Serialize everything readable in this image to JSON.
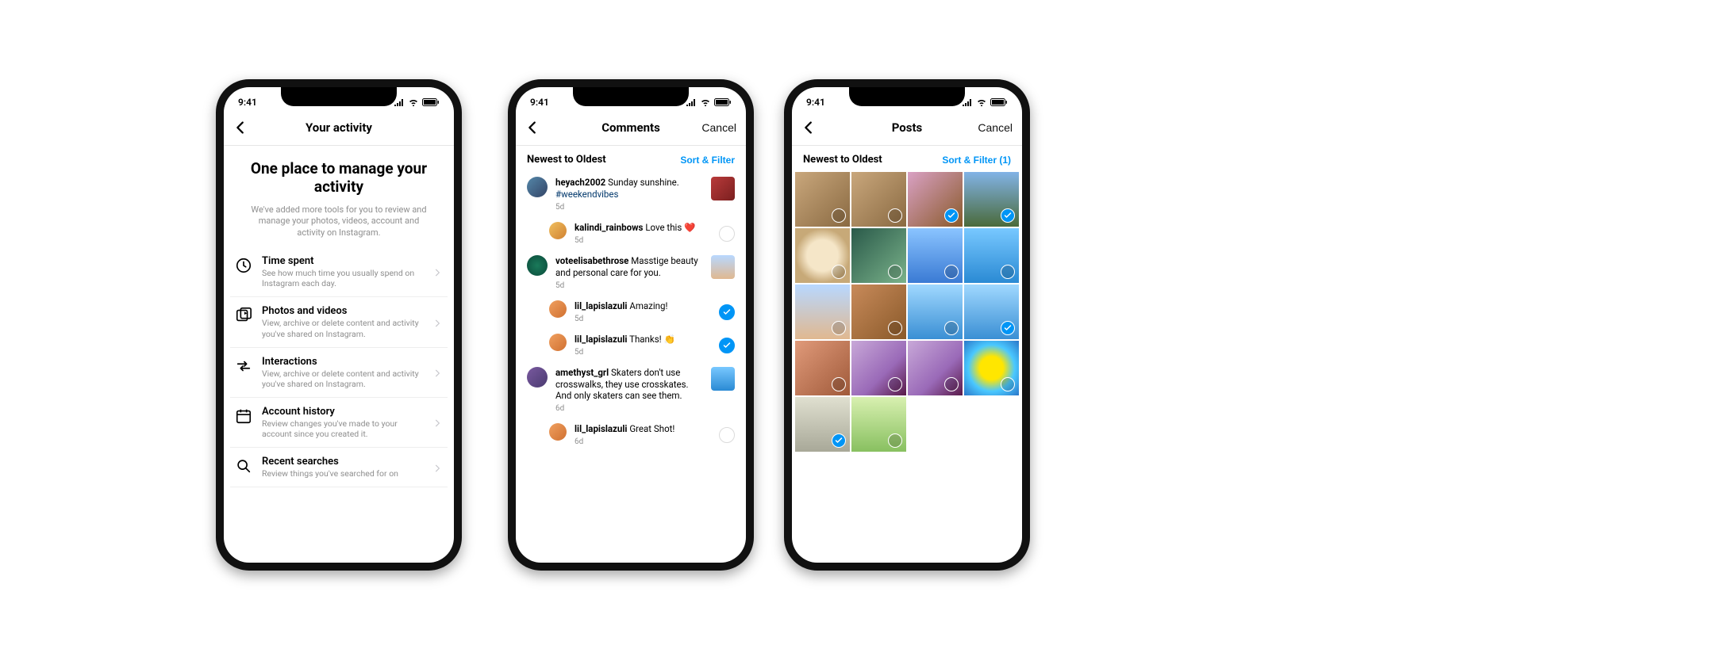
{
  "statusbar": {
    "time": "9:41"
  },
  "colors": {
    "link": "#0095f6"
  },
  "phone1": {
    "title": "Your activity",
    "hero_title": "One place to manage your activity",
    "hero_subtitle": "We've added more tools for you to review and manage your photos, videos, account and activity on Instagram.",
    "items": [
      {
        "icon": "clock",
        "title": "Time spent",
        "subtitle": "See how much time you usually spend on Instagram each day."
      },
      {
        "icon": "media",
        "title": "Photos and videos",
        "subtitle": "View, archive or delete content and activity you've shared on Instagram."
      },
      {
        "icon": "arrows",
        "title": "Interactions",
        "subtitle": "View, archive or delete content and activity you've shared on Instagram."
      },
      {
        "icon": "calendar",
        "title": "Account history",
        "subtitle": "Review changes you've made to your account since you created it."
      },
      {
        "icon": "search",
        "title": "Recent searches",
        "subtitle": "Review things you've searched for on"
      }
    ]
  },
  "phone2": {
    "title": "Comments",
    "cancel": "Cancel",
    "sort_label": "Newest to Oldest",
    "sort_button": "Sort & Filter",
    "comments": [
      {
        "id": 0,
        "reply": false,
        "user": "heyach2002",
        "text": "Sunday sunshine.",
        "extra": "#weekendvibes",
        "meta": "5d",
        "thumb": true,
        "thumb_class": "g-red",
        "check": false,
        "checked": false,
        "avatar_bg": "linear-gradient(135deg,#58a,#346)"
      },
      {
        "id": 1,
        "reply": true,
        "user": "kalindi_rainbows",
        "text": "Love this ❤️",
        "meta": "5d",
        "thumb": false,
        "check": true,
        "checked": false,
        "avatar_bg": "linear-gradient(135deg,#f0c060,#d08030)"
      },
      {
        "id": 2,
        "reply": false,
        "user": "voteelisabethrose",
        "text": "Masstige beauty and personal care for you.",
        "meta": "5d",
        "thumb": true,
        "thumb_class": "g-model",
        "check": false,
        "checked": false,
        "avatar_bg": "radial-gradient(#1a7a5a,#0a4a3a)"
      },
      {
        "id": 3,
        "reply": true,
        "user": "lil_lapislazuli",
        "text": "Amazing!",
        "meta": "5d",
        "thumb": false,
        "check": true,
        "checked": true,
        "avatar_bg": "linear-gradient(135deg,#f0a060,#d07030)"
      },
      {
        "id": 4,
        "reply": true,
        "user": "lil_lapislazuli",
        "text": "Thanks! 👏",
        "meta": "5d",
        "thumb": false,
        "check": true,
        "checked": true,
        "avatar_bg": "linear-gradient(135deg,#f0a060,#d07030)"
      },
      {
        "id": 5,
        "reply": false,
        "user": "amethyst_grl",
        "text": "Skaters don't use crosswalks, they use crosskates. And only skaters can see them.",
        "meta": "6d",
        "thumb": true,
        "thumb_class": "g-skate",
        "check": false,
        "checked": false,
        "avatar_bg": "linear-gradient(135deg,#7a5aa0,#4a3a70)"
      },
      {
        "id": 6,
        "reply": true,
        "user": "lil_lapislazuli",
        "text": "Great Shot!",
        "meta": "6d",
        "thumb": false,
        "check": true,
        "checked": false,
        "avatar_bg": "linear-gradient(135deg,#f0a060,#d07030)"
      }
    ]
  },
  "phone3": {
    "title": "Posts",
    "cancel": "Cancel",
    "sort_label": "Newest to Oldest",
    "sort_button": "Sort & Filter (1)",
    "tiles": [
      {
        "id": 0,
        "bg": "g-group",
        "checked": false
      },
      {
        "id": 1,
        "bg": "g-group",
        "checked": false
      },
      {
        "id": 2,
        "bg": "g-flowers",
        "checked": true
      },
      {
        "id": 3,
        "bg": "g-hill",
        "checked": true
      },
      {
        "id": 4,
        "bg": "g-umbrella",
        "checked": false
      },
      {
        "id": 5,
        "bg": "g-camera",
        "checked": false
      },
      {
        "id": 6,
        "bg": "g-yoga",
        "checked": false
      },
      {
        "id": 7,
        "bg": "g-skate",
        "checked": false
      },
      {
        "id": 8,
        "bg": "g-model",
        "checked": false
      },
      {
        "id": 9,
        "bg": "g-barcelona",
        "checked": false
      },
      {
        "id": 10,
        "bg": "g-bluesky",
        "checked": false
      },
      {
        "id": 11,
        "bg": "g-bluesky",
        "checked": true
      },
      {
        "id": 12,
        "bg": "g-pair",
        "checked": false
      },
      {
        "id": 13,
        "bg": "g-selfie",
        "checked": false
      },
      {
        "id": 14,
        "bg": "g-selfie",
        "checked": false
      },
      {
        "id": 15,
        "bg": "g-spiral",
        "checked": false
      },
      {
        "id": 16,
        "bg": "g-building",
        "checked": true
      },
      {
        "id": 17,
        "bg": "g-green",
        "checked": false
      }
    ]
  }
}
